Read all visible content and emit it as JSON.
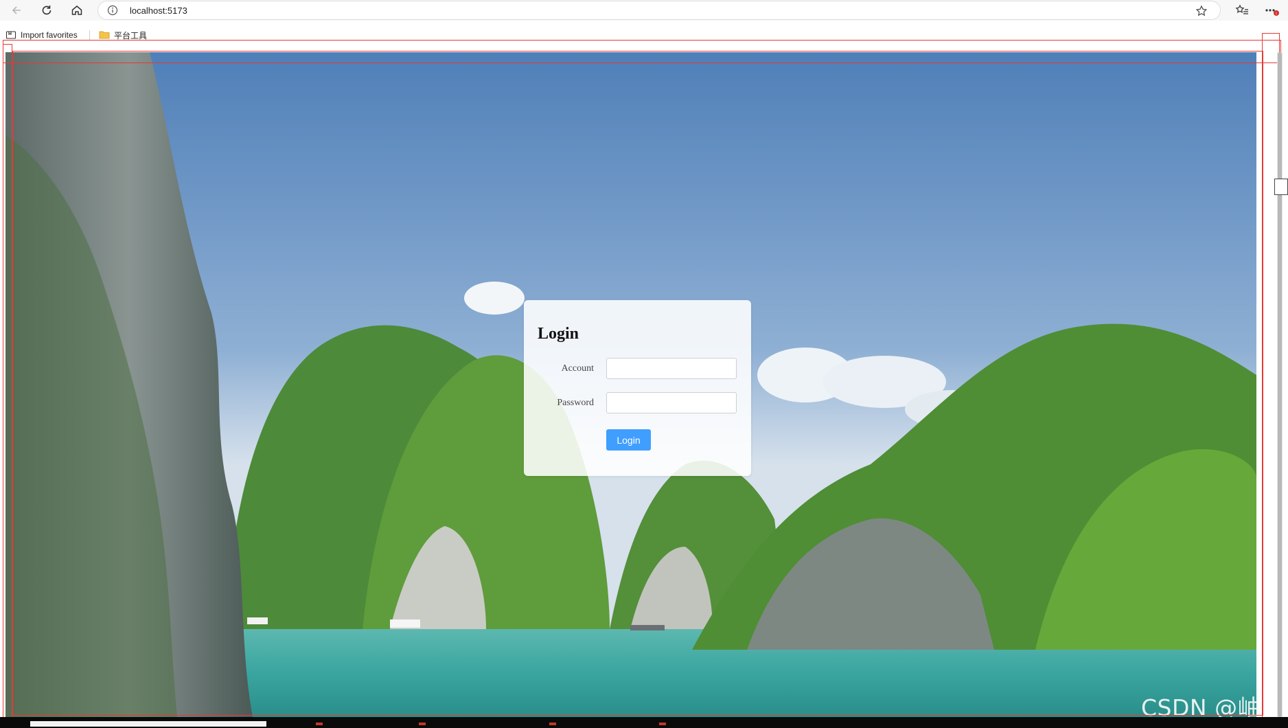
{
  "browser": {
    "url": "localhost:5173",
    "favorites": [
      {
        "label": "Import favorites",
        "icon": "import-favorites-icon"
      },
      {
        "label": "平台工具",
        "icon": "folder-icon"
      }
    ],
    "icons": {
      "back": "back-arrow-icon",
      "reload": "reload-icon",
      "home": "home-icon",
      "info": "site-info-icon",
      "star": "star-icon",
      "favorites": "favorites-icon",
      "more": "more-icon"
    },
    "colors": {
      "accent_badge": "#d32f2f"
    }
  },
  "login": {
    "title": "Login",
    "account_label": "Account",
    "account_value": "",
    "password_label": "Password",
    "password_value": "",
    "button_label": "Login",
    "button_color": "#409eff"
  },
  "watermark": "CSDN @岫珩"
}
